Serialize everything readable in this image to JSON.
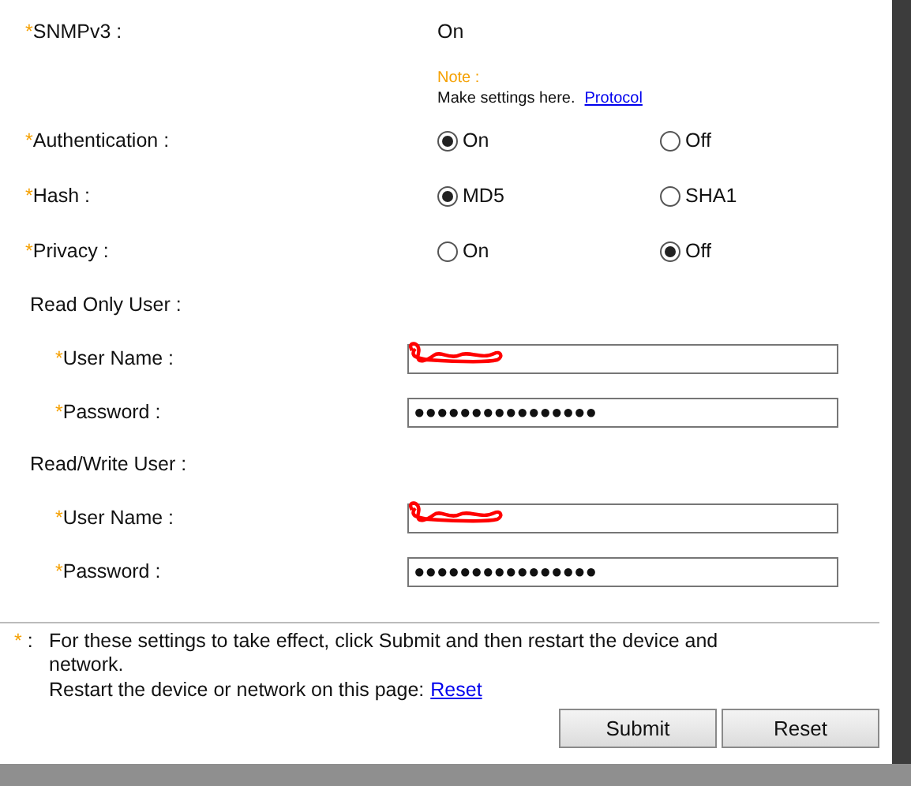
{
  "rows": [
    {
      "kind": "value",
      "mark": "*",
      "label": "SNMPv3 :",
      "value": "On"
    },
    {
      "kind": "note",
      "title": "Note :",
      "text": "Make settings here.",
      "link": "Protocol"
    },
    {
      "kind": "radio",
      "mark": "*",
      "label": "Authentication :",
      "options": [
        {
          "label": "On",
          "selected": true
        },
        {
          "label": "Off",
          "selected": false
        }
      ]
    },
    {
      "kind": "radio",
      "mark": "*",
      "label": "Hash :",
      "options": [
        {
          "label": "MD5",
          "selected": true
        },
        {
          "label": "SHA1",
          "selected": false
        }
      ]
    },
    {
      "kind": "radio",
      "mark": "*",
      "label": "Privacy :",
      "options": [
        {
          "label": "On",
          "selected": false
        },
        {
          "label": "Off",
          "selected": true
        }
      ]
    },
    {
      "kind": "section",
      "label": "Read Only User :",
      "children": [
        {
          "kind": "field",
          "mark": "*",
          "label": "User Name :",
          "redacted": true
        },
        {
          "kind": "field",
          "mark": "*",
          "label": "Password :",
          "value": "●●●●●●●●●●●●●●●●"
        }
      ]
    },
    {
      "kind": "section",
      "label": "Read/Write User :",
      "children": [
        {
          "kind": "field",
          "mark": "*",
          "label": "User Name :",
          "redacted": true
        },
        {
          "kind": "field",
          "mark": "*",
          "label": "Password :",
          "value": "●●●●●●●●●●●●●●●●"
        }
      ]
    }
  ],
  "footnote": {
    "mark": "*",
    "separator": ":",
    "text": "For these settings to take effect, click Submit and then restart the device and network.",
    "restart_text": "Restart the device or network on this page:",
    "restart_link": "Reset"
  },
  "buttons": [
    "Submit",
    "Reset"
  ]
}
